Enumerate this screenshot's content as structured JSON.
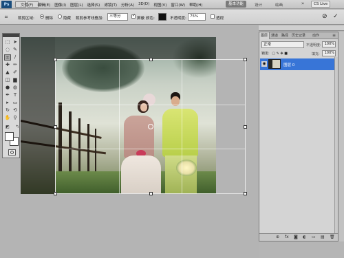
{
  "menubar": {
    "logo": "Ps",
    "items": [
      "文件(F)",
      "编辑(E)",
      "图像(I)",
      "图层(L)",
      "选择(S)",
      "滤镜(T)",
      "分析(A)",
      "3D(D)",
      "视图(V)",
      "窗口(W)",
      "帮助(H)"
    ],
    "zoom": "100%",
    "workspace_active": "基本功能",
    "workspaces": [
      "设计",
      "绘画"
    ],
    "more": "»",
    "cs_live": "CS Live",
    "window_buttons": [
      "–",
      "□",
      "×"
    ]
  },
  "options": {
    "crop_area_label": "裁剪区域:",
    "delete_label": "删除",
    "hide_label": "隐藏",
    "overlay_label": "裁剪参考线叠加:",
    "overlay_value": "三等分",
    "shield_label": "屏蔽",
    "color_label": "颜色:",
    "opacity_label": "不透明度:",
    "opacity_value": "75%",
    "perspective_label": "透视",
    "cancel_icon": "⊘",
    "commit_icon": "✓"
  },
  "layers": {
    "tabs": [
      "图层",
      "通道",
      "路径",
      "历史记录",
      "动作"
    ],
    "blend_mode": "正常",
    "opacity_label": "不透明度:",
    "opacity_value": "100%",
    "lock_label": "锁定:",
    "fill_label": "填充:",
    "fill_value": "100%",
    "layer_name": "图层 0",
    "footer_icons": [
      "⊕",
      "fx",
      "◙",
      "◐",
      "▭",
      "▤",
      "🗑"
    ]
  },
  "colors": {
    "selection_blue": "#3875d7",
    "panel_gray": "#d4d4d4",
    "workspace_gray": "#b4b4b4"
  }
}
